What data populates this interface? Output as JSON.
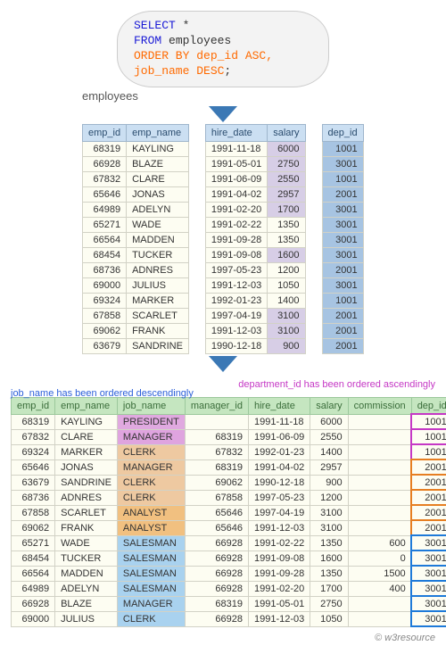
{
  "sql": {
    "select": "SELECT",
    "star": " *",
    "from": "FROM",
    "from_tbl": " employees",
    "order": "ORDER BY",
    "order_cols": " dep_id ASC,",
    "order_cols2": "job_name DESC",
    "semicolon": ";"
  },
  "caption1": "employees",
  "t1": {
    "headers": [
      "emp_id",
      "emp_name",
      "hire_date",
      "salary",
      "dep_id"
    ],
    "rows": [
      {
        "emp_id": 68319,
        "emp_name": "KAYLING",
        "hire_date": "1991-11-18",
        "salary": 6000,
        "dep_id": 1001,
        "sal_hi": true
      },
      {
        "emp_id": 66928,
        "emp_name": "BLAZE",
        "hire_date": "1991-05-01",
        "salary": 2750,
        "dep_id": 3001,
        "sal_hi": true
      },
      {
        "emp_id": 67832,
        "emp_name": "CLARE",
        "hire_date": "1991-06-09",
        "salary": 2550,
        "dep_id": 1001,
        "sal_hi": true
      },
      {
        "emp_id": 65646,
        "emp_name": "JONAS",
        "hire_date": "1991-04-02",
        "salary": 2957,
        "dep_id": 2001,
        "sal_hi": true
      },
      {
        "emp_id": 64989,
        "emp_name": "ADELYN",
        "hire_date": "1991-02-20",
        "salary": 1700,
        "dep_id": 3001,
        "sal_hi": true
      },
      {
        "emp_id": 65271,
        "emp_name": "WADE",
        "hire_date": "1991-02-22",
        "salary": 1350,
        "dep_id": 3001,
        "sal_hi": false
      },
      {
        "emp_id": 66564,
        "emp_name": "MADDEN",
        "hire_date": "1991-09-28",
        "salary": 1350,
        "dep_id": 3001,
        "sal_hi": false
      },
      {
        "emp_id": 68454,
        "emp_name": "TUCKER",
        "hire_date": "1991-09-08",
        "salary": 1600,
        "dep_id": 3001,
        "sal_hi": true
      },
      {
        "emp_id": 68736,
        "emp_name": "ADNRES",
        "hire_date": "1997-05-23",
        "salary": 1200,
        "dep_id": 2001,
        "sal_hi": false
      },
      {
        "emp_id": 69000,
        "emp_name": "JULIUS",
        "hire_date": "1991-12-03",
        "salary": 1050,
        "dep_id": 3001,
        "sal_hi": false
      },
      {
        "emp_id": 69324,
        "emp_name": "MARKER",
        "hire_date": "1992-01-23",
        "salary": 1400,
        "dep_id": 1001,
        "sal_hi": false
      },
      {
        "emp_id": 67858,
        "emp_name": "SCARLET",
        "hire_date": "1997-04-19",
        "salary": 3100,
        "dep_id": 2001,
        "sal_hi": true
      },
      {
        "emp_id": 69062,
        "emp_name": "FRANK",
        "hire_date": "1991-12-03",
        "salary": 3100,
        "dep_id": 2001,
        "sal_hi": true
      },
      {
        "emp_id": 63679,
        "emp_name": "SANDRINE",
        "hire_date": "1990-12-18",
        "salary": 900,
        "dep_id": 2001,
        "sal_hi": true
      }
    ]
  },
  "note_left": "job_name has been ordered descendingly",
  "note_right": "department_id has been ordered ascendingly",
  "t2": {
    "headers": [
      "emp_id",
      "emp_name",
      "job_name",
      "manager_id",
      "hire_date",
      "salary",
      "commission",
      "dep_id"
    ],
    "rows": [
      {
        "emp_id": 68319,
        "emp_name": "KAYLING",
        "job_name": "PRESIDENT",
        "job_cls": "job-pres",
        "manager_id": "",
        "hire_date": "1991-11-18",
        "salary": 6000,
        "commission": "",
        "dep_id": 1001,
        "dep_cls": "dep-g1"
      },
      {
        "emp_id": 67832,
        "emp_name": "CLARE",
        "job_name": "MANAGER",
        "job_cls": "job-mgr",
        "manager_id": 68319,
        "hire_date": "1991-06-09",
        "salary": 2550,
        "commission": "",
        "dep_id": 1001,
        "dep_cls": "dep-g1"
      },
      {
        "emp_id": 69324,
        "emp_name": "MARKER",
        "job_name": "CLERK",
        "job_cls": "job-clk",
        "manager_id": 67832,
        "hire_date": "1992-01-23",
        "salary": 1400,
        "commission": "",
        "dep_id": 1001,
        "dep_cls": "dep-g1"
      },
      {
        "emp_id": 65646,
        "emp_name": "JONAS",
        "job_name": "MANAGER",
        "job_cls": "job-clk",
        "manager_id": 68319,
        "hire_date": "1991-04-02",
        "salary": 2957,
        "commission": "",
        "dep_id": 2001,
        "dep_cls": "dep-g2"
      },
      {
        "emp_id": 63679,
        "emp_name": "SANDRINE",
        "job_name": "CLERK",
        "job_cls": "job-clk",
        "manager_id": 69062,
        "hire_date": "1990-12-18",
        "salary": 900,
        "commission": "",
        "dep_id": 2001,
        "dep_cls": "dep-g2"
      },
      {
        "emp_id": 68736,
        "emp_name": "ADNRES",
        "job_name": "CLERK",
        "job_cls": "job-clk",
        "manager_id": 67858,
        "hire_date": "1997-05-23",
        "salary": 1200,
        "commission": "",
        "dep_id": 2001,
        "dep_cls": "dep-g2"
      },
      {
        "emp_id": 67858,
        "emp_name": "SCARLET",
        "job_name": "ANALYST",
        "job_cls": "job-ana",
        "manager_id": 65646,
        "hire_date": "1997-04-19",
        "salary": 3100,
        "commission": "",
        "dep_id": 2001,
        "dep_cls": "dep-g2"
      },
      {
        "emp_id": 69062,
        "emp_name": "FRANK",
        "job_name": "ANALYST",
        "job_cls": "job-ana",
        "manager_id": 65646,
        "hire_date": "1991-12-03",
        "salary": 3100,
        "commission": "",
        "dep_id": 2001,
        "dep_cls": "dep-g2"
      },
      {
        "emp_id": 65271,
        "emp_name": "WADE",
        "job_name": "SALESMAN",
        "job_cls": "job-sal",
        "manager_id": 66928,
        "hire_date": "1991-02-22",
        "salary": 1350,
        "commission": 600,
        "dep_id": 3001,
        "dep_cls": "dep-g3"
      },
      {
        "emp_id": 68454,
        "emp_name": "TUCKER",
        "job_name": "SALESMAN",
        "job_cls": "job-sal",
        "manager_id": 66928,
        "hire_date": "1991-09-08",
        "salary": 1600,
        "commission": 0,
        "dep_id": 3001,
        "dep_cls": "dep-g3"
      },
      {
        "emp_id": 66564,
        "emp_name": "MADDEN",
        "job_name": "SALESMAN",
        "job_cls": "job-sal",
        "manager_id": 66928,
        "hire_date": "1991-09-28",
        "salary": 1350,
        "commission": 1500,
        "dep_id": 3001,
        "dep_cls": "dep-g3"
      },
      {
        "emp_id": 64989,
        "emp_name": "ADELYN",
        "job_name": "SALESMAN",
        "job_cls": "job-sal",
        "manager_id": 66928,
        "hire_date": "1991-02-20",
        "salary": 1700,
        "commission": 400,
        "dep_id": 3001,
        "dep_cls": "dep-g3"
      },
      {
        "emp_id": 66928,
        "emp_name": "BLAZE",
        "job_name": "MANAGER",
        "job_cls": "job-mgr2",
        "manager_id": 68319,
        "hire_date": "1991-05-01",
        "salary": 2750,
        "commission": "",
        "dep_id": 3001,
        "dep_cls": "dep-g3"
      },
      {
        "emp_id": 69000,
        "emp_name": "JULIUS",
        "job_name": "CLERK",
        "job_cls": "job-mgr2",
        "manager_id": 66928,
        "hire_date": "1991-12-03",
        "salary": 1050,
        "commission": "",
        "dep_id": 3001,
        "dep_cls": "dep-g3"
      }
    ]
  },
  "footer": "© w3resource"
}
